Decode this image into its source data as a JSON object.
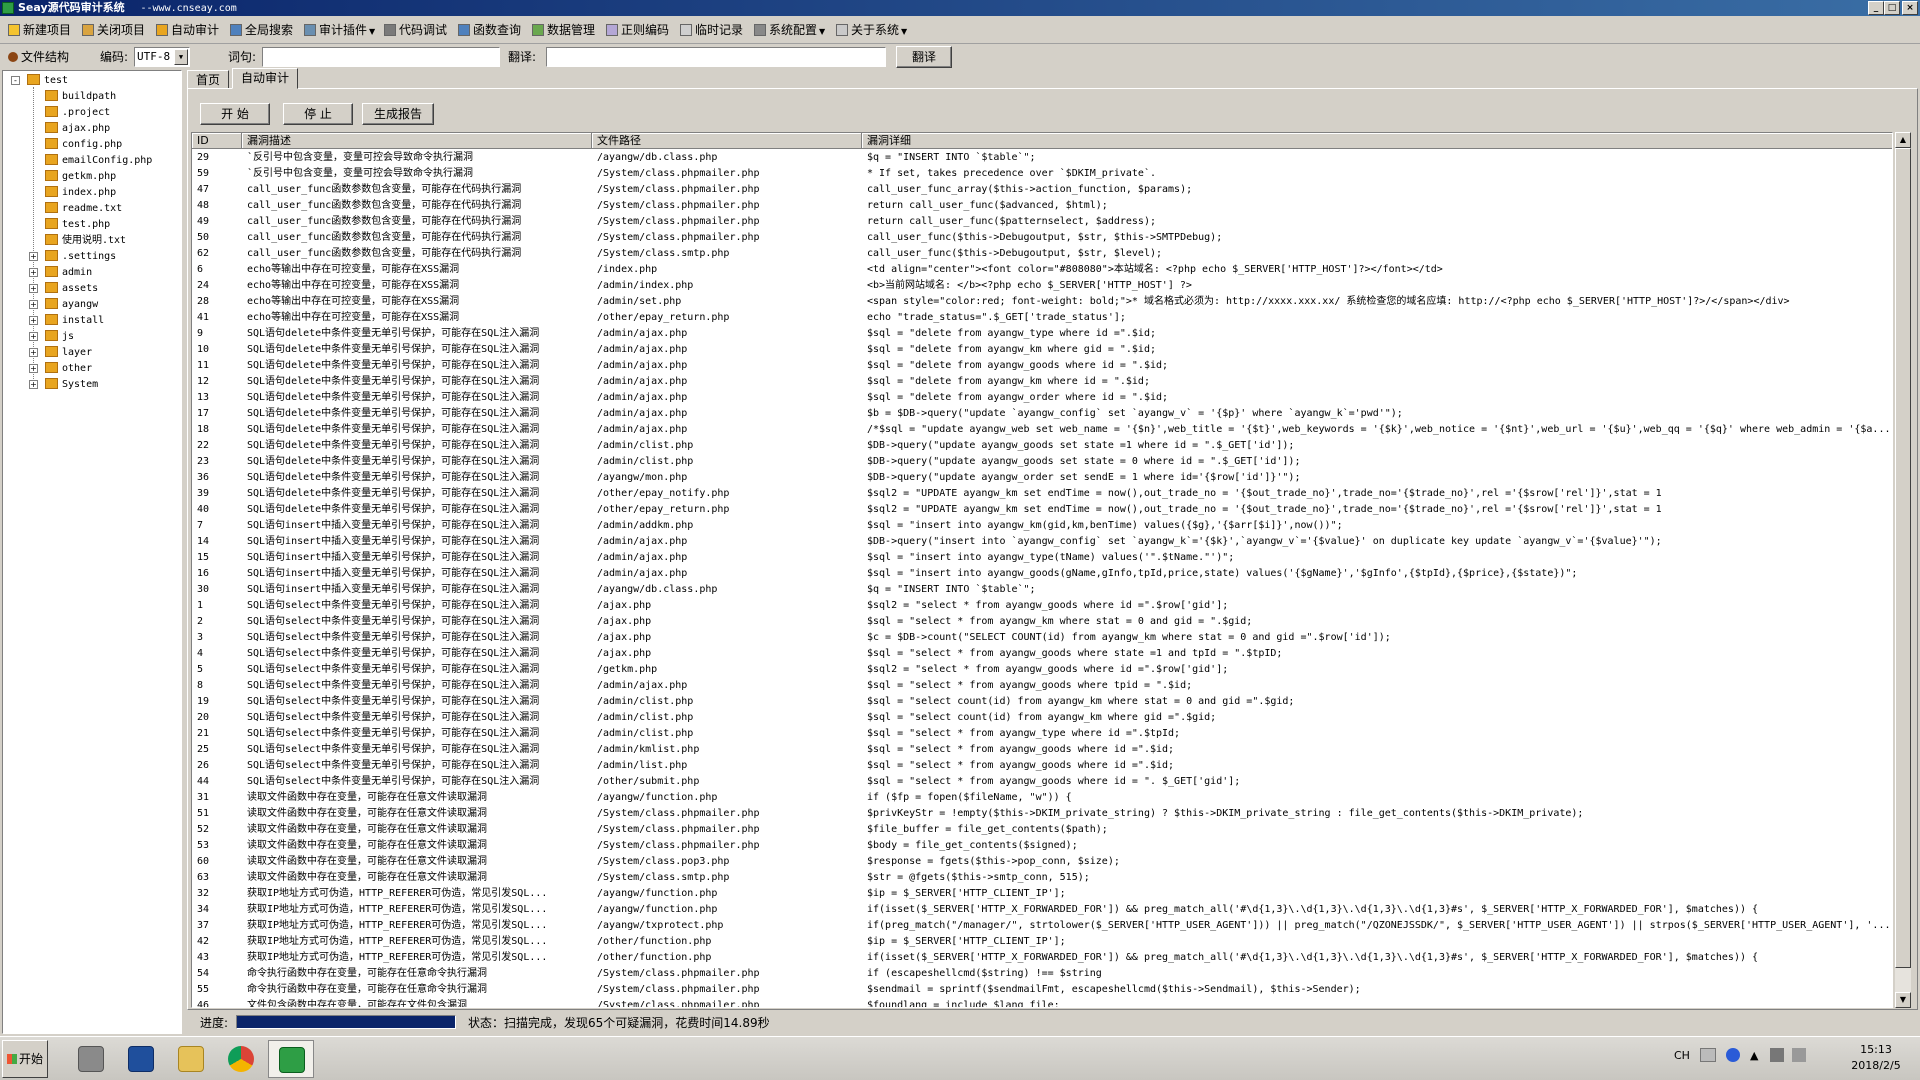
{
  "window": {
    "title": "Seay源代码审计系统",
    "subtitle": "--www.cnseay.com",
    "min": "_",
    "max": "□",
    "close": "×"
  },
  "menu": [
    {
      "label": "新建项目",
      "icon": "new-project-icon",
      "dropdown": false
    },
    {
      "label": "关闭项目",
      "icon": "close-project-icon",
      "dropdown": false
    },
    {
      "label": "自动审计",
      "icon": "auto-audit-icon",
      "dropdown": false
    },
    {
      "label": "全局搜索",
      "icon": "global-search-icon",
      "dropdown": false
    },
    {
      "label": "审计插件",
      "icon": "plugin-icon",
      "dropdown": true
    },
    {
      "label": "代码调试",
      "icon": "debug-icon",
      "dropdown": false
    },
    {
      "label": "函数查询",
      "icon": "function-search-icon",
      "dropdown": false
    },
    {
      "label": "数据管理",
      "icon": "data-manage-icon",
      "dropdown": false
    },
    {
      "label": "正则编码",
      "icon": "regex-icon",
      "dropdown": false
    },
    {
      "label": "临时记录",
      "icon": "notes-icon",
      "dropdown": false
    },
    {
      "label": "系统配置",
      "icon": "settings-icon",
      "dropdown": true
    },
    {
      "label": "关于系统",
      "icon": "about-icon",
      "dropdown": true
    }
  ],
  "toolbar": {
    "file_structure": "文件结构",
    "encoding_label": "编码:",
    "encoding_value": "UTF-8",
    "word_label": "词句:",
    "word_value": "",
    "translate_label": "翻译:",
    "translate_value": "",
    "translate_button": "翻译"
  },
  "tree": {
    "root": "test",
    "files": [
      "buildpath",
      ".project",
      "ajax.php",
      "config.php",
      "emailConfig.php",
      "getkm.php",
      "index.php",
      "readme.txt",
      "test.php",
      "使用说明.txt"
    ],
    "folders": [
      ".settings",
      "admin",
      "assets",
      "ayangw",
      "install",
      "js",
      "layer",
      "other",
      "System"
    ]
  },
  "tabs": [
    "首页",
    "自动审计"
  ],
  "actions": {
    "start": "开 始",
    "stop": "停 止",
    "report": "生成报告"
  },
  "columns": [
    "ID",
    "漏洞描述",
    "文件路径",
    "漏洞详细"
  ],
  "rows": [
    [
      "29",
      "`反引号中包含变量，变量可控会导致命令执行漏洞",
      "/ayangw/db.class.php",
      "$q = \"INSERT INTO `$table`\";"
    ],
    [
      "59",
      "`反引号中包含变量，变量可控会导致命令执行漏洞",
      "/System/class.phpmailer.php",
      "* If set, takes precedence over `$DKIM_private`."
    ],
    [
      "47",
      "call_user_func函数参数包含变量，可能存在代码执行漏洞",
      "/System/class.phpmailer.php",
      "call_user_func_array($this->action_function, $params);"
    ],
    [
      "48",
      "call_user_func函数参数包含变量，可能存在代码执行漏洞",
      "/System/class.phpmailer.php",
      "return call_user_func($advanced, $html);"
    ],
    [
      "49",
      "call_user_func函数参数包含变量，可能存在代码执行漏洞",
      "/System/class.phpmailer.php",
      "return call_user_func($patternselect, $address);"
    ],
    [
      "50",
      "call_user_func函数参数包含变量，可能存在代码执行漏洞",
      "/System/class.phpmailer.php",
      "call_user_func($this->Debugoutput, $str, $this->SMTPDebug);"
    ],
    [
      "62",
      "call_user_func函数参数包含变量，可能存在代码执行漏洞",
      "/System/class.smtp.php",
      "call_user_func($this->Debugoutput, $str, $level);"
    ],
    [
      "6",
      "echo等输出中存在可控变量，可能存在XSS漏洞",
      "/index.php",
      "<td align=\"center\"><font color=\"#808080\">本站域名: <?php echo $_SERVER['HTTP_HOST']?></font></td>"
    ],
    [
      "24",
      "echo等输出中存在可控变量，可能存在XSS漏洞",
      "/admin/index.php",
      "<b>当前网站域名: </b><?php echo $_SERVER['HTTP_HOST'] ?>"
    ],
    [
      "28",
      "echo等输出中存在可控变量，可能存在XSS漏洞",
      "/admin/set.php",
      "<span style=\"color:red; font-weight: bold;\">* 域名格式必须为: http://xxxx.xxx.xx/ 系统检查您的域名应填: http://<?php echo  $_SERVER['HTTP_HOST']?>/</span></div>"
    ],
    [
      "41",
      "echo等输出中存在可控变量，可能存在XSS漏洞",
      "/other/epay_return.php",
      "echo \"trade_status=\".$_GET['trade_status'];"
    ],
    [
      "9",
      "SQL语句delete中条件变量无单引号保护，可能存在SQL注入漏洞",
      "/admin/ajax.php",
      "$sql = \"delete from ayangw_type where id =\".$id;"
    ],
    [
      "10",
      "SQL语句delete中条件变量无单引号保护，可能存在SQL注入漏洞",
      "/admin/ajax.php",
      "$sql = \"delete from ayangw_km where gid = \".$id;"
    ],
    [
      "11",
      "SQL语句delete中条件变量无单引号保护，可能存在SQL注入漏洞",
      "/admin/ajax.php",
      "$sql = \"delete from ayangw_goods where id = \".$id;"
    ],
    [
      "12",
      "SQL语句delete中条件变量无单引号保护，可能存在SQL注入漏洞",
      "/admin/ajax.php",
      "$sql = \"delete from ayangw_km where id = \".$id;"
    ],
    [
      "13",
      "SQL语句delete中条件变量无单引号保护，可能存在SQL注入漏洞",
      "/admin/ajax.php",
      "$sql = \"delete from ayangw_order where id = \".$id;"
    ],
    [
      "17",
      "SQL语句delete中条件变量无单引号保护，可能存在SQL注入漏洞",
      "/admin/ajax.php",
      "$b = $DB->query(\"update `ayangw_config` set `ayangw_v` = '{$p}' where `ayangw_k`='pwd'\");"
    ],
    [
      "18",
      "SQL语句delete中条件变量无单引号保护，可能存在SQL注入漏洞",
      "/admin/ajax.php",
      "/*$sql = \"update ayangw_web set web_name = '{$n}',web_title = '{$t}',web_keywords = '{$k}',web_notice = '{$nt}',web_url = '{$u}',web_qq = '{$q}' where web_admin = '{$a..."
    ],
    [
      "22",
      "SQL语句delete中条件变量无单引号保护，可能存在SQL注入漏洞",
      "/admin/clist.php",
      "$DB->query(\"update ayangw_goods set state =1 where id = \".$_GET['id']);"
    ],
    [
      "23",
      "SQL语句delete中条件变量无单引号保护，可能存在SQL注入漏洞",
      "/admin/clist.php",
      "$DB->query(\"update ayangw_goods set state = 0 where id = \".$_GET['id']);"
    ],
    [
      "36",
      "SQL语句delete中条件变量无单引号保护，可能存在SQL注入漏洞",
      "/ayangw/mon.php",
      "$DB->query(\"update ayangw_order set sendE = 1 where id='{$row['id']}'\");"
    ],
    [
      "39",
      "SQL语句delete中条件变量无单引号保护，可能存在SQL注入漏洞",
      "/other/epay_notify.php",
      "$sql2 = \"UPDATE ayangw_km set endTime = now(),out_trade_no = '{$out_trade_no}',trade_no='{$trade_no}',rel ='{$srow['rel']}',stat = 1"
    ],
    [
      "40",
      "SQL语句delete中条件变量无单引号保护，可能存在SQL注入漏洞",
      "/other/epay_return.php",
      "$sql2 = \"UPDATE ayangw_km set endTime = now(),out_trade_no = '{$out_trade_no}',trade_no='{$trade_no}',rel ='{$srow['rel']}',stat = 1"
    ],
    [
      "7",
      "SQL语句insert中插入变量无单引号保护，可能存在SQL注入漏洞",
      "/admin/addkm.php",
      "$sql = \"insert into ayangw_km(gid,km,benTime) values({$g},'{$arr[$i]}',now())\";"
    ],
    [
      "14",
      "SQL语句insert中插入变量无单引号保护，可能存在SQL注入漏洞",
      "/admin/ajax.php",
      "$DB->query(\"insert into `ayangw_config` set `ayangw_k`='{$k}',`ayangw_v`='{$value}' on duplicate key update `ayangw_v`='{$value}'\");"
    ],
    [
      "15",
      "SQL语句insert中插入变量无单引号保护，可能存在SQL注入漏洞",
      "/admin/ajax.php",
      "$sql = \"insert into ayangw_type(tName) values('\".$tName.\"')\";"
    ],
    [
      "16",
      "SQL语句insert中插入变量无单引号保护，可能存在SQL注入漏洞",
      "/admin/ajax.php",
      "$sql = \"insert into ayangw_goods(gName,gInfo,tpId,price,state) values('{$gName}','$gInfo',{$tpId},{$price},{$state})\";"
    ],
    [
      "30",
      "SQL语句insert中插入变量无单引号保护，可能存在SQL注入漏洞",
      "/ayangw/db.class.php",
      "$q = \"INSERT INTO `$table`\";"
    ],
    [
      "1",
      "SQL语句select中条件变量无单引号保护，可能存在SQL注入漏洞",
      "/ajax.php",
      "$sql2 = \"select * from ayangw_goods where id =\".$row['gid'];"
    ],
    [
      "2",
      "SQL语句select中条件变量无单引号保护，可能存在SQL注入漏洞",
      "/ajax.php",
      "$sql = \"select * from ayangw_km where stat = 0 and gid = \".$gid;"
    ],
    [
      "3",
      "SQL语句select中条件变量无单引号保护，可能存在SQL注入漏洞",
      "/ajax.php",
      "$c = $DB->count(\"SELECT COUNT(id) from ayangw_km  where stat = 0 and gid =\".$row['id']);"
    ],
    [
      "4",
      "SQL语句select中条件变量无单引号保护，可能存在SQL注入漏洞",
      "/ajax.php",
      "$sql = \"select * from ayangw_goods where  state =1 and tpId = \".$tpID;"
    ],
    [
      "5",
      "SQL语句select中条件变量无单引号保护，可能存在SQL注入漏洞",
      "/getkm.php",
      "$sql2 = \"select * from ayangw_goods where id =\".$row['gid'];"
    ],
    [
      "8",
      "SQL语句select中条件变量无单引号保护，可能存在SQL注入漏洞",
      "/admin/ajax.php",
      "$sql = \"select * from ayangw_goods where tpid = \".$id;"
    ],
    [
      "19",
      "SQL语句select中条件变量无单引号保护，可能存在SQL注入漏洞",
      "/admin/clist.php",
      "$sql = \"select count(id) from ayangw_km where stat = 0 and gid =\".$gid;"
    ],
    [
      "20",
      "SQL语句select中条件变量无单引号保护，可能存在SQL注入漏洞",
      "/admin/clist.php",
      "$sql = \"select count(id) from ayangw_km where gid =\".$gid;"
    ],
    [
      "21",
      "SQL语句select中条件变量无单引号保护，可能存在SQL注入漏洞",
      "/admin/clist.php",
      "$sql = \"select * from ayangw_type where id =\".$tpId;"
    ],
    [
      "25",
      "SQL语句select中条件变量无单引号保护，可能存在SQL注入漏洞",
      "/admin/kmlist.php",
      "$sql = \"select * from ayangw_goods where id =\".$id;"
    ],
    [
      "26",
      "SQL语句select中条件变量无单引号保护，可能存在SQL注入漏洞",
      "/admin/list.php",
      "$sql = \"select * from ayangw_goods where id =\".$id;"
    ],
    [
      "44",
      "SQL语句select中条件变量无单引号保护，可能存在SQL注入漏洞",
      "/other/submit.php",
      "$sql = \"select * from  ayangw_goods where id = \". $_GET['gid'];"
    ],
    [
      "31",
      "读取文件函数中存在变量，可能存在任意文件读取漏洞",
      "/ayangw/function.php",
      "if ($fp = fopen($fileName, \"w\")) {"
    ],
    [
      "51",
      "读取文件函数中存在变量，可能存在任意文件读取漏洞",
      "/System/class.phpmailer.php",
      "$privKeyStr = !empty($this->DKIM_private_string) ? $this->DKIM_private_string : file_get_contents($this->DKIM_private);"
    ],
    [
      "52",
      "读取文件函数中存在变量，可能存在任意文件读取漏洞",
      "/System/class.phpmailer.php",
      "$file_buffer = file_get_contents($path);"
    ],
    [
      "53",
      "读取文件函数中存在变量，可能存在任意文件读取漏洞",
      "/System/class.phpmailer.php",
      "$body = file_get_contents($signed);"
    ],
    [
      "60",
      "读取文件函数中存在变量，可能存在任意文件读取漏洞",
      "/System/class.pop3.php",
      "$response = fgets($this->pop_conn, $size);"
    ],
    [
      "63",
      "读取文件函数中存在变量，可能存在任意文件读取漏洞",
      "/System/class.smtp.php",
      "$str = @fgets($this->smtp_conn, 515);"
    ],
    [
      "32",
      "获取IP地址方式可伪造，HTTP_REFERER可伪造，常见引发SQL...",
      "/ayangw/function.php",
      "$ip = $_SERVER['HTTP_CLIENT_IP'];"
    ],
    [
      "34",
      "获取IP地址方式可伪造，HTTP_REFERER可伪造，常见引发SQL...",
      "/ayangw/function.php",
      "if(isset($_SERVER['HTTP_X_FORWARDED_FOR']) && preg_match_all('#\\d{1,3}\\.\\d{1,3}\\.\\d{1,3}\\.\\d{1,3}#s', $_SERVER['HTTP_X_FORWARDED_FOR'], $matches)) {"
    ],
    [
      "37",
      "获取IP地址方式可伪造，HTTP_REFERER可伪造，常见引发SQL...",
      "/ayangw/txprotect.php",
      "if(preg_match(\"/manager/\", strtolower($_SERVER['HTTP_USER_AGENT'])) || preg_match(\"/QZONEJSSDK/\", $_SERVER['HTTP_USER_AGENT']) || strpos($_SERVER['HTTP_USER_AGENT'], '..."
    ],
    [
      "42",
      "获取IP地址方式可伪造，HTTP_REFERER可伪造，常见引发SQL...",
      "/other/function.php",
      "$ip = $_SERVER['HTTP_CLIENT_IP'];"
    ],
    [
      "43",
      "获取IP地址方式可伪造，HTTP_REFERER可伪造，常见引发SQL...",
      "/other/function.php",
      "if(isset($_SERVER['HTTP_X_FORWARDED_FOR']) && preg_match_all('#\\d{1,3}\\.\\d{1,3}\\.\\d{1,3}\\.\\d{1,3}#s', $_SERVER['HTTP_X_FORWARDED_FOR'], $matches)) {"
    ],
    [
      "54",
      "命令执行函数中存在变量，可能存在任意命令执行漏洞",
      "/System/class.phpmailer.php",
      "if (escapeshellcmd($string) !== $string"
    ],
    [
      "55",
      "命令执行函数中存在变量，可能存在任意命令执行漏洞",
      "/System/class.phpmailer.php",
      "$sendmail = sprintf($sendmailFmt, escapeshellcmd($this->Sendmail), $this->Sender);"
    ],
    [
      "46",
      "文件包含函数中存在变量，可能存在文件包含漏洞",
      "/System/class.phpmailer.php",
      "$foundlang = include $lang_file;"
    ]
  ],
  "status": {
    "progress_label": "进度:",
    "progress_fraction": 1.0,
    "text": "状态：扫描完成，发现65个可疑漏洞，花费时间14.89秒"
  },
  "taskbar": {
    "start": "开始",
    "apps": [
      "server-manager-icon",
      "powershell-icon",
      "file-explorer-icon",
      "chrome-icon",
      "seay-app-icon"
    ],
    "lang": "CH",
    "time": "15:13",
    "date": "2018/2/5"
  },
  "colors": {
    "titlebar": "#0a246a",
    "progress_fill": "#0a246a",
    "folder": "#e8a520",
    "app_green": "#2e9e45"
  }
}
